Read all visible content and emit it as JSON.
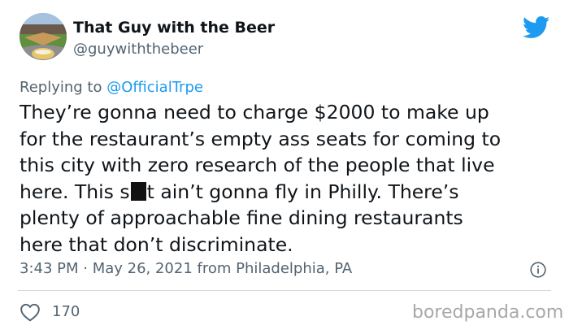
{
  "tweet": {
    "display_name": "That Guy with the Beer",
    "handle": "@guywiththebeer",
    "replying_prefix": "Replying to ",
    "replying_to": "@OfficialTrpe",
    "body_lines": [
      "They’re gonna need to charge $2000 to make up",
      "for the restaurant’s empty ass seats for coming to",
      "this city with zero research of the people that live",
      "here. This s",
      "t ain’t gonna fly in Philly. There’s",
      "plenty of approachable fine dining restaurants",
      "here that don’t discriminate."
    ],
    "timestamp": "3:43 PM · May 26, 2021 from Philadelphia, PA",
    "likes": "170"
  },
  "watermark": "boredpanda.com",
  "icons": {
    "brand": "twitter-bird-icon",
    "info": "info-icon",
    "like": "heart-icon"
  },
  "colors": {
    "twitter_blue": "#1d9bf0",
    "secondary_text": "#536471",
    "primary_text": "#0f1419"
  }
}
